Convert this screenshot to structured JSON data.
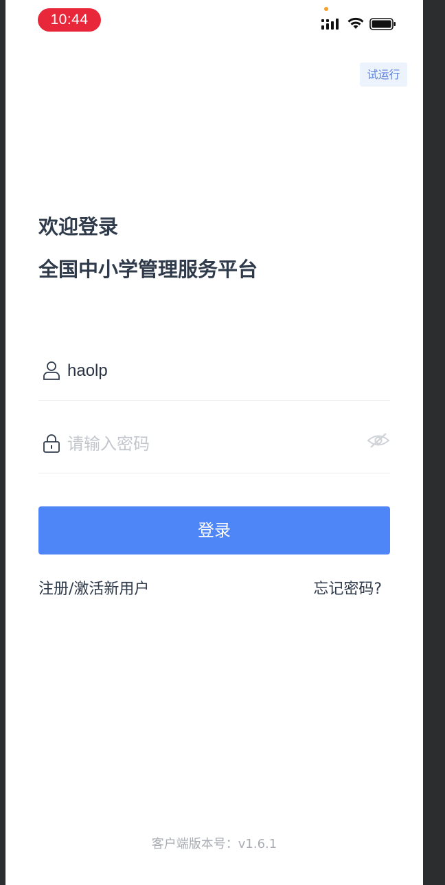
{
  "status_bar": {
    "time": "10:44"
  },
  "header": {
    "trial_badge": "试运行"
  },
  "title": {
    "welcome": "欢迎登录",
    "platform": "全国中小学管理服务平台"
  },
  "form": {
    "username_value": "haolp",
    "password_placeholder": "请输入密码",
    "login_label": "登录"
  },
  "links": {
    "register": "注册/激活新用户",
    "forgot": "忘记密码?"
  },
  "footer": {
    "version": "客户端版本号：v1.6.1"
  },
  "colors": {
    "primary": "#4f86f7",
    "time_pill": "#e8283a",
    "badge_bg": "#edf3fd",
    "badge_text": "#5d84d8"
  },
  "icons": {
    "user": "user-icon",
    "lock": "lock-icon",
    "eye": "eye-hidden-icon",
    "signal": "cellular-signal-icon",
    "wifi": "wifi-icon",
    "battery": "battery-icon"
  }
}
